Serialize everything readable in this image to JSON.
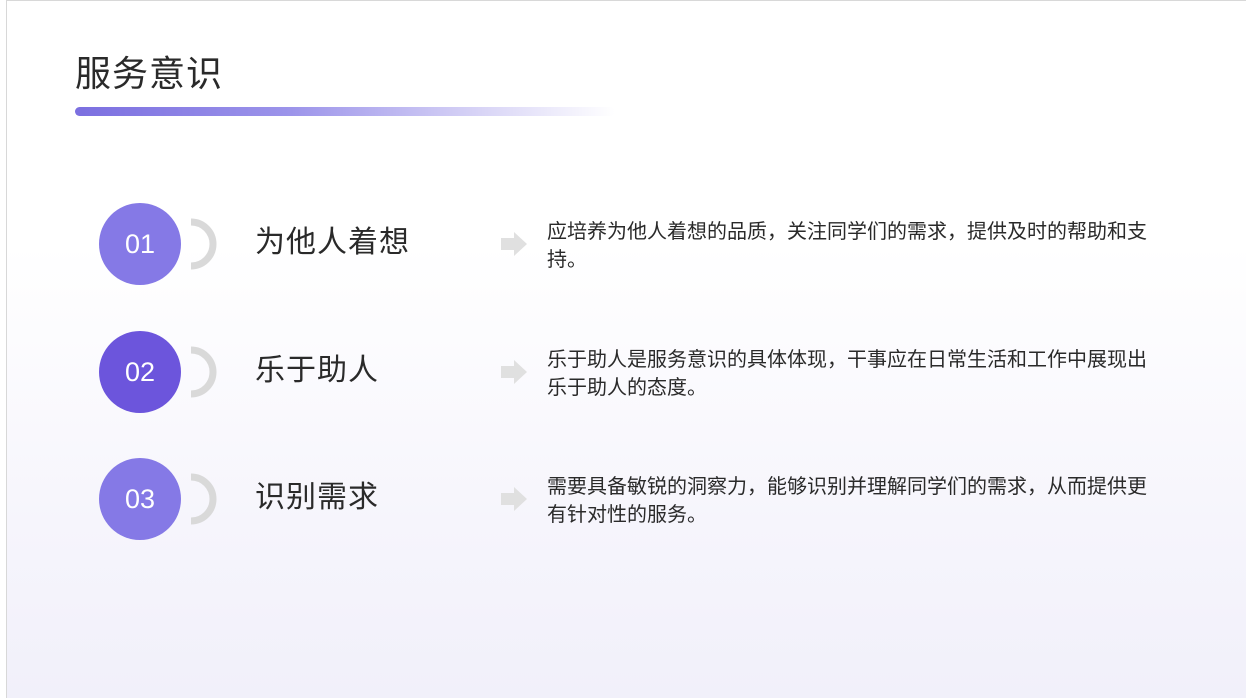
{
  "slide": {
    "title": "服务意识"
  },
  "items": [
    {
      "number": "01",
      "heading": "为他人着想",
      "description": "应培养为他人着想的品质，关注同学们的需求，提供及时的帮助和支持。"
    },
    {
      "number": "02",
      "heading": "乐于助人",
      "description": "乐于助人是服务意识的具体体现，干事应在日常生活和工作中展现出乐于助人的态度。"
    },
    {
      "number": "03",
      "heading": "识别需求",
      "description": "需要具备敏锐的洞察力，能够识别并理解同学们的需求，从而提供更有针对性的服务。"
    }
  ],
  "colors": {
    "accent_light": "#8579e6",
    "accent_dark": "#6c55dc",
    "arc_gray": "#d9d9d9"
  },
  "icons": {
    "arrow": "arrow-right-icon",
    "arc": "half-ring-icon"
  }
}
